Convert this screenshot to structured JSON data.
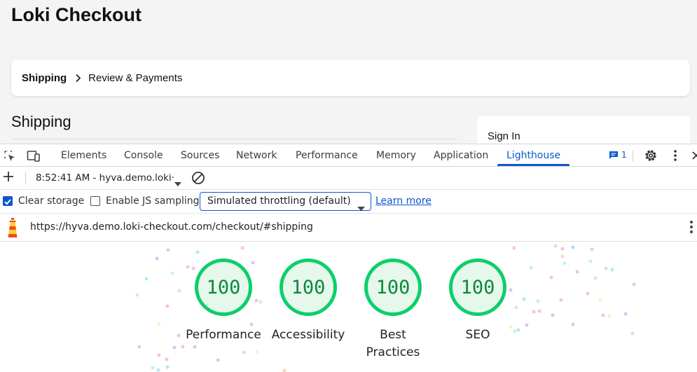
{
  "page": {
    "title": "Loki Checkout",
    "steps": {
      "current": "Shipping",
      "next": "Review & Payments"
    },
    "section_heading": "Shipping",
    "sidebar": {
      "signin_label": "Sign In"
    }
  },
  "devtools": {
    "tabs": [
      "Elements",
      "Console",
      "Sources",
      "Network",
      "Performance",
      "Memory",
      "Application",
      "Lighthouse"
    ],
    "active_tab": "Lighthouse",
    "message_count": "1",
    "icons": [
      "select-element-icon",
      "device-toolbar-icon",
      "message-icon",
      "gear-icon",
      "kebab-icon",
      "close-icon"
    ]
  },
  "lighthouse": {
    "report_selector": "8:52:41 AM - hyva.demo.loki·",
    "settings": {
      "clear_storage": {
        "label": "Clear storage",
        "checked": true
      },
      "js_sampling": {
        "label": "Enable JS sampling",
        "checked": false
      },
      "throttling": "Simulated throttling (default)",
      "learn_more": "Learn more"
    },
    "url": "https://hyva.demo.loki-checkout.com/checkout/#shipping",
    "scores": [
      {
        "category": "Performance",
        "score": "100"
      },
      {
        "category": "Accessibility",
        "score": "100"
      },
      {
        "category": "Best Practices",
        "score": "100"
      },
      {
        "category": "SEO",
        "score": "100"
      }
    ],
    "colors": {
      "pass": "#0ccf6a",
      "pass_text": "#0a8a3a",
      "pass_fill": "#e6f7ec",
      "accent": "#0b57d0"
    }
  }
}
